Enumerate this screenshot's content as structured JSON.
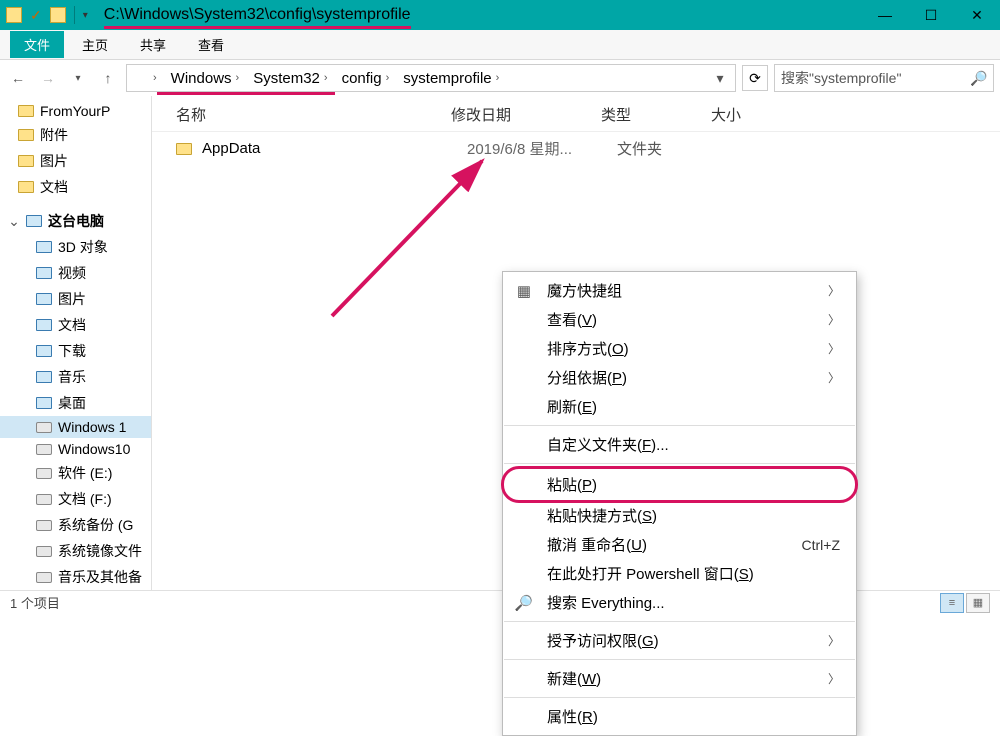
{
  "title_path": "C:\\Windows\\System32\\config\\systemprofile",
  "ribbon": {
    "file": "文件",
    "home": "主页",
    "share": "共享",
    "view": "查看"
  },
  "breadcrumb": [
    "Windows",
    "System32",
    "config",
    "systemprofile"
  ],
  "search_placeholder": "搜索\"systemprofile\"",
  "columns": {
    "name": "名称",
    "date": "修改日期",
    "type": "类型",
    "size": "大小"
  },
  "rows": [
    {
      "name": "AppData",
      "date": "2019/6/8 星期...",
      "type": "文件夹"
    }
  ],
  "sidebar": {
    "items": [
      {
        "label": "FromYourP",
        "icon": "folder"
      },
      {
        "label": "附件",
        "icon": "folder"
      },
      {
        "label": "图片",
        "icon": "folder"
      },
      {
        "label": "文档",
        "icon": "folder"
      }
    ],
    "pc_header": "这台电脑",
    "pc_items": [
      {
        "label": "3D 对象",
        "icon": "pc"
      },
      {
        "label": "视频",
        "icon": "pc"
      },
      {
        "label": "图片",
        "icon": "pc"
      },
      {
        "label": "文档",
        "icon": "pc"
      },
      {
        "label": "下载",
        "icon": "pc"
      },
      {
        "label": "音乐",
        "icon": "pc"
      },
      {
        "label": "桌面",
        "icon": "pc"
      },
      {
        "label": "Windows 1",
        "icon": "drive",
        "selected": true
      },
      {
        "label": "Windows10",
        "icon": "drive"
      },
      {
        "label": "软件 (E:)",
        "icon": "drive"
      },
      {
        "label": "文档 (F:)",
        "icon": "drive"
      },
      {
        "label": "系统备份 (G",
        "icon": "drive"
      },
      {
        "label": "系统镜像文件",
        "icon": "drive"
      },
      {
        "label": "音乐及其他备",
        "icon": "drive"
      }
    ]
  },
  "context_menu": [
    {
      "label": "魔方快捷组",
      "icon": "grid",
      "sub": true
    },
    {
      "label": "查看(V)",
      "u": "V",
      "sub": true
    },
    {
      "label": "排序方式(O)",
      "u": "O",
      "sub": true
    },
    {
      "label": "分组依据(P)",
      "u": "P",
      "sub": true
    },
    {
      "label": "刷新(E)",
      "u": "E"
    },
    {
      "sep": true
    },
    {
      "label": "自定义文件夹(F)...",
      "u": "F"
    },
    {
      "sep": true
    },
    {
      "label": "粘贴(P)",
      "u": "P",
      "highlight": true
    },
    {
      "label": "粘贴快捷方式(S)",
      "u": "S"
    },
    {
      "label": "撤消 重命名(U)",
      "u": "U",
      "shortcut": "Ctrl+Z"
    },
    {
      "label": "在此处打开 Powershell 窗口(S)",
      "u": "S"
    },
    {
      "label": "搜索 Everything...",
      "icon": "search"
    },
    {
      "sep": true
    },
    {
      "label": "授予访问权限(G)",
      "u": "G",
      "sub": true
    },
    {
      "sep": true
    },
    {
      "label": "新建(W)",
      "u": "W",
      "sub": true
    },
    {
      "sep": true
    },
    {
      "label": "属性(R)",
      "u": "R"
    }
  ],
  "status": "1 个项目"
}
